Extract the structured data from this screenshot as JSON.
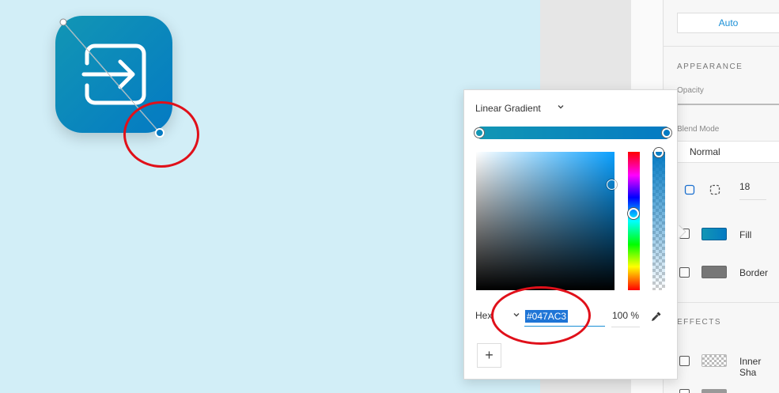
{
  "right_panel": {
    "auto_label": "Auto",
    "appearance_title": "APPEARANCE",
    "opacity_label": "Opacity",
    "blend_mode_label": "Blend Mode",
    "blend_mode_value": "Normal",
    "corner_radius": "18",
    "fill_label": "Fill",
    "fill_color": "#047ac3",
    "border_label": "Border",
    "border_color": "#777777",
    "effects_title": "EFFECTS",
    "inner_shadow_label": "Inner Sha"
  },
  "color_picker": {
    "gradient_type": "Linear Gradient",
    "gradient_start_color": "#1296b4",
    "gradient_end_color": "#047ac3",
    "mode_label": "Hex",
    "hex_value": "#047AC3",
    "opacity_value": "100 %",
    "add_stop_label": "+"
  },
  "annotations": {
    "highlight_color": "#e0101a"
  },
  "icons": [
    "exit-icon",
    "chevron-down-icon",
    "eyedropper-icon",
    "corner-individual-icon",
    "corner-uniform-icon"
  ]
}
